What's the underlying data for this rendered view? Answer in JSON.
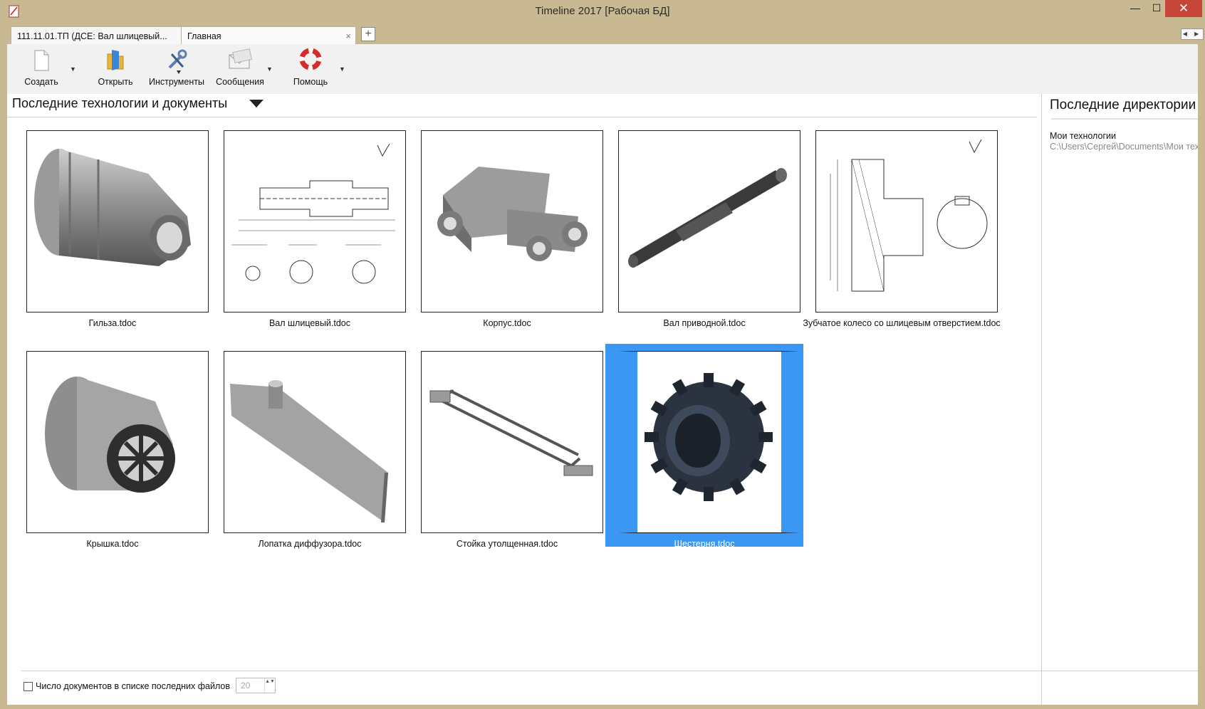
{
  "window": {
    "title": "Timeline 2017   [Рабочая БД]",
    "minimize": "—",
    "maximize": "☐",
    "close": "✕"
  },
  "tabs": [
    {
      "label": "111.11.01.ТП (ДСЕ: Вал шлицевый..."
    },
    {
      "label": "Главная"
    }
  ],
  "tab_close": "×",
  "tab_add": "+",
  "tab_nav": "◀ ▶",
  "ribbon": {
    "create": "Создать",
    "open": "Открыть",
    "tools": "Инструменты",
    "messages": "Сообщения",
    "help": "Помощь",
    "arrow": "▼"
  },
  "recent": {
    "title": "Последние технологии и документы",
    "documents": [
      {
        "name": "Гильза.tdoc",
        "thumb": "sleeve-icon"
      },
      {
        "name": "Вал шлицевый.tdoc",
        "thumb": "drawing-icon"
      },
      {
        "name": "Корпус.tdoc",
        "thumb": "housing-icon"
      },
      {
        "name": "Вал приводной.tdoc",
        "thumb": "shaft-icon"
      },
      {
        "name": "Зубчатое колесо со шлицевым отверстием.tdoc",
        "thumb": "drawing-icon"
      },
      {
        "name": "Крышка.tdoc",
        "thumb": "cover-icon"
      },
      {
        "name": "Лопатка диффузора.tdoc",
        "thumb": "blade-icon"
      },
      {
        "name": "Стойка утолщенная.tdoc",
        "thumb": "rack-icon"
      },
      {
        "name": "Шестерня.tdoc",
        "thumb": "gear-icon"
      }
    ]
  },
  "directories": {
    "title": "Последние директории",
    "items": [
      {
        "name": "Мои технологии",
        "path": "C:\\Users\\Сергей\\Documents\\Мои технологии"
      }
    ]
  },
  "options": {
    "doc_count_label": "Число документов в списке последних файлов",
    "doc_count_value": "20",
    "spin_arrows": "▲▼"
  },
  "colors": {
    "selection": "#3b97f4",
    "window_frame": "#c9b993",
    "close_button": "#c7463a"
  }
}
